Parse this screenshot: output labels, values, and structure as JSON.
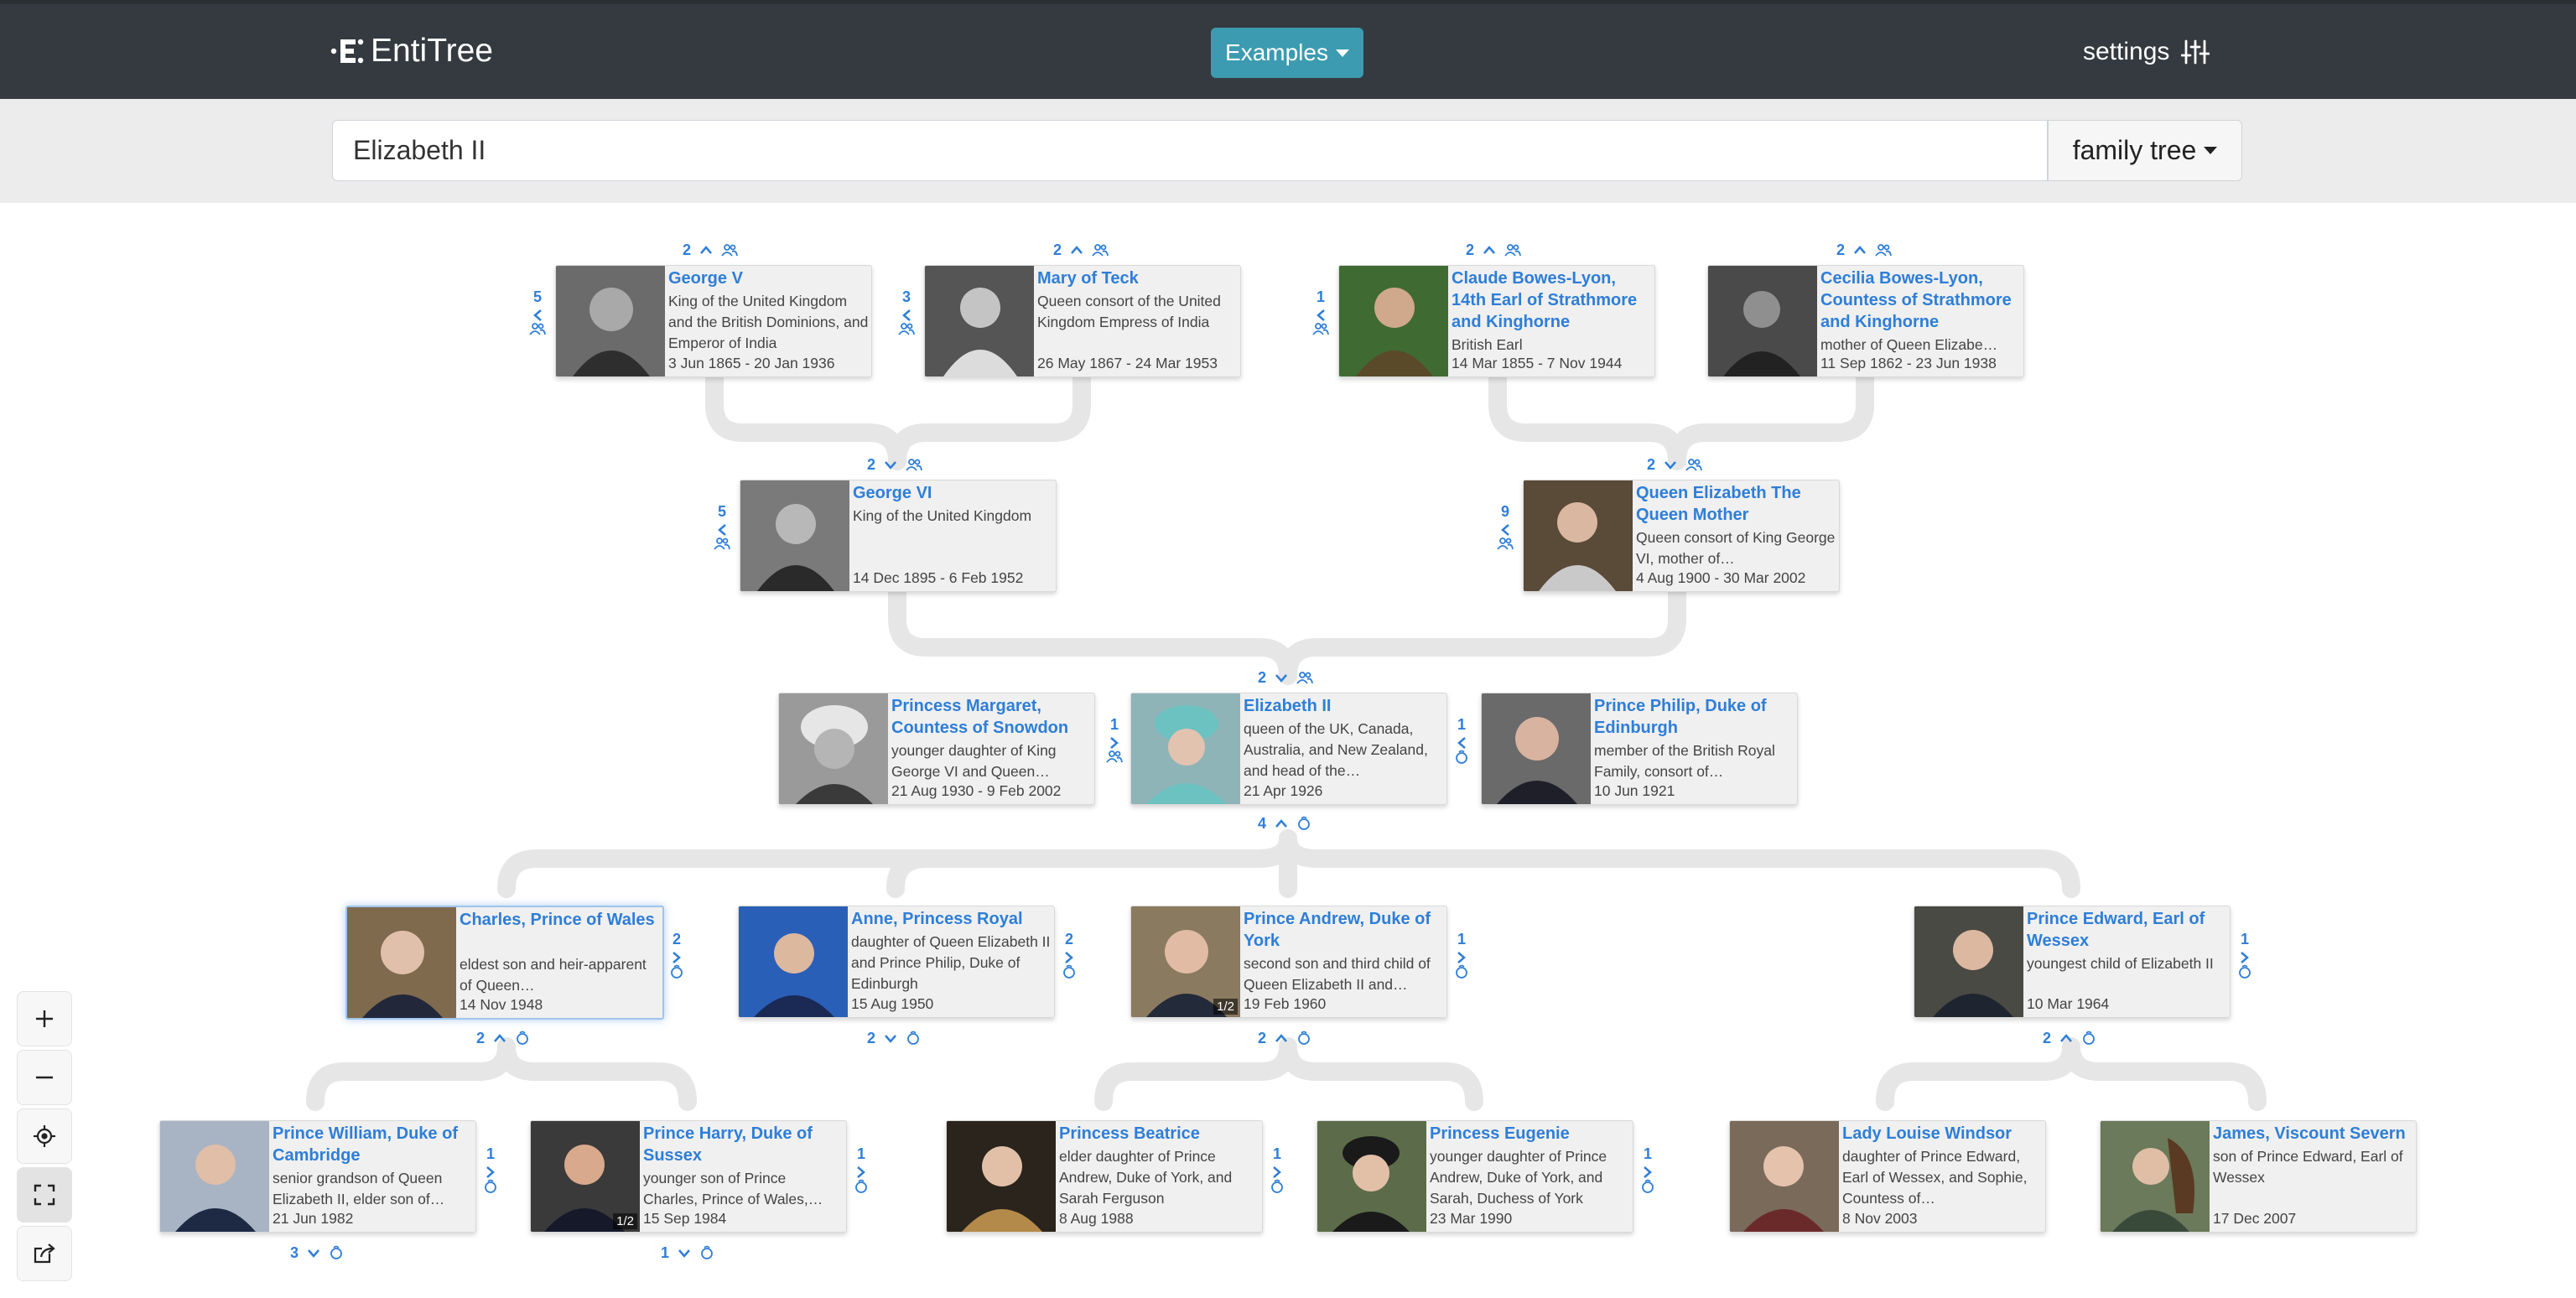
{
  "app": {
    "brand": "EntiTree"
  },
  "nav": {
    "examples_label": "Examples",
    "settings_label": "settings"
  },
  "search": {
    "value": "Elizabeth II",
    "mode_label": "family tree"
  },
  "people": {
    "george_v": {
      "name": "George V",
      "desc": "King of the United Kingdom and the British Dominions, and Emperor of India",
      "dates": "3 Jun 1865 - 20 Jan 1936",
      "side_count": "5",
      "top_count": "2"
    },
    "mary": {
      "name": "Mary of Teck",
      "desc": "Queen consort of the United Kingdom Empress of India",
      "dates": "26 May 1867 - 24 Mar 1953",
      "side_count": "3",
      "top_count": "2"
    },
    "claude": {
      "name": "Claude Bowes-Lyon, 14th Earl of Strathmore and Kinghorne",
      "desc": "British Earl",
      "dates": "14 Mar 1855 - 7 Nov 1944",
      "side_count": "1",
      "top_count": "2"
    },
    "cecilia": {
      "name": "Cecilia Bowes-Lyon, Countess of Strathmore and Kinghorne",
      "desc": "mother of Queen Elizabe…",
      "dates": "11 Sep 1862 - 23 Jun 1938",
      "top_count": "2"
    },
    "george_vi": {
      "name": "George VI",
      "desc": "King of the United Kingdom",
      "dates": "14 Dec 1895 - 6 Feb 1952",
      "side_count": "5",
      "top_count": "2"
    },
    "queen_mother": {
      "name": "Queen Elizabeth The Queen Mother",
      "desc": "Queen consort of King George VI, mother of…",
      "dates": "4 Aug 1900 - 30 Mar 2002",
      "side_count": "9",
      "top_count": "2"
    },
    "margaret": {
      "name": "Princess Margaret, Countess of Snowdon",
      "desc": "younger daughter of King George VI and Queen…",
      "dates": "21 Aug 1930 - 9 Feb 2002"
    },
    "elizabeth": {
      "name": "Elizabeth II",
      "desc": "queen of the UK, Canada, Australia, and New Zealand, and head of the…",
      "dates": "21 Apr 1926",
      "side_count": "1",
      "top_count": "2",
      "bottom_count": "4"
    },
    "philip": {
      "name": "Prince Philip, Duke of Edinburgh",
      "desc": "member of the British Royal Family, consort of…",
      "dates": "10 Jun 1921",
      "side_count": "1"
    },
    "charles": {
      "name": "Charles, Prince of Wales",
      "desc": "eldest son and heir-apparent of Queen…",
      "dates": "14 Nov 1948",
      "side_count": "2",
      "bottom_count": "2"
    },
    "anne": {
      "name": "Anne, Princess Royal",
      "desc": "daughter of Queen Elizabeth II and Prince Philip, Duke of Edinburgh",
      "dates": "15 Aug 1950",
      "side_count": "2",
      "bottom_count": "2"
    },
    "andrew": {
      "name": "Prince Andrew, Duke of York",
      "desc": "second son and third child of Queen Elizabeth II and…",
      "dates": "19 Feb 1960",
      "side_count": "1",
      "bottom_count": "2",
      "badge": "1/2"
    },
    "edward": {
      "name": "Prince Edward, Earl of Wessex",
      "desc": "youngest child of Elizabeth II",
      "dates": "10 Mar 1964",
      "side_count": "1",
      "bottom_count": "2"
    },
    "william": {
      "name": "Prince William, Duke of Cambridge",
      "desc": "senior grandson of Queen Elizabeth II, elder son of…",
      "dates": "21 Jun 1982",
      "side_count": "1",
      "bottom_count": "3"
    },
    "harry": {
      "name": "Prince Harry, Duke of Sussex",
      "desc": "younger son of Prince Charles, Prince of Wales,…",
      "dates": "15 Sep 1984",
      "side_count": "1",
      "bottom_count": "1",
      "badge": "1/2"
    },
    "beatrice": {
      "name": "Princess Beatrice",
      "desc": "elder daughter of Prince Andrew, Duke of York, and Sarah Ferguson",
      "dates": "8 Aug 1988",
      "side_count": "1"
    },
    "eugenie": {
      "name": "Princess Eugenie",
      "desc": "younger daughter of Prince Andrew, Duke of York, and Sarah, Duchess of York",
      "dates": "23 Mar 1990",
      "side_count": "1"
    },
    "louise": {
      "name": "Lady Louise Windsor",
      "desc": "daughter of Prince Edward, Earl of Wessex, and Sophie, Countess of…",
      "dates": "8 Nov 2003"
    },
    "james": {
      "name": "James, Viscount Severn",
      "desc": "son of Prince Edward, Earl of Wessex",
      "dates": "17 Dec 2007"
    }
  },
  "colors": {
    "navbar": "#343a40",
    "examples_button": "#3c9bb0",
    "link_blue": "#2e7ed8",
    "card_bg": "#f0f0f0",
    "connector": "#e6e6e6"
  },
  "icons": [
    "logo-icon",
    "settings-sliders-icon",
    "chevron-up-icon",
    "chevron-down-icon",
    "chevron-left-icon",
    "chevron-right-icon",
    "siblings-icon",
    "spouse-icon",
    "children-icon",
    "zoom-in-icon",
    "zoom-out-icon",
    "center-focus-icon",
    "fullscreen-icon",
    "share-icon"
  ]
}
